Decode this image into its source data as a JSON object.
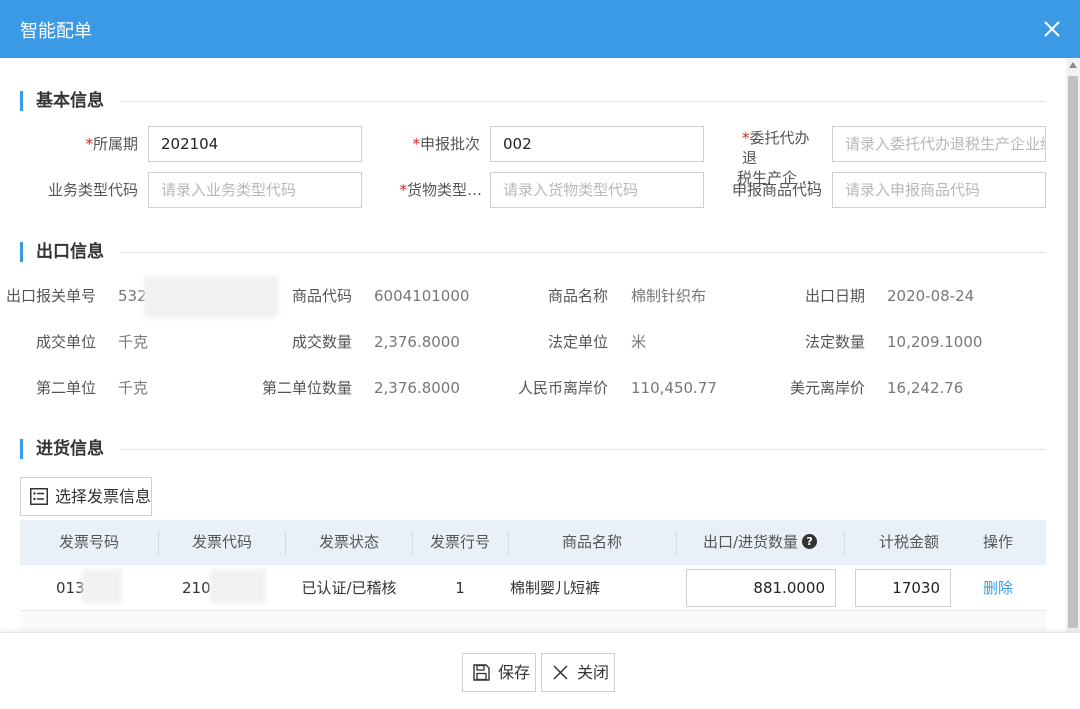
{
  "dialog": {
    "title": "智能配单",
    "colors": {
      "header": "#3a9ae6",
      "link": "#3a9ae6",
      "required": "#e02020"
    }
  },
  "sections": {
    "basic": "基本信息",
    "export": "出口信息",
    "purchase": "进货信息"
  },
  "basic_form": {
    "period_label": "所属期",
    "period_value": "202104",
    "batch_label": "申报批次",
    "batch_value": "002",
    "entrust_label_line1": "委托代办退",
    "entrust_label_line2": "税生产企 …",
    "entrust_placeholder": "请录入委托代办退税生产企业纳",
    "biztype_label": "业务类型代码",
    "biztype_placeholder": "请录入业务类型代码",
    "goodstype_label": "货物类型…",
    "goodstype_placeholder": "请录入货物类型代码",
    "declaregoods_label": "申报商品代码",
    "declaregoods_placeholder": "请录入申报商品代码"
  },
  "export_info": {
    "customs_no_label": "出口报关单号",
    "customs_no_value": "532",
    "goods_code_label": "商品代码",
    "goods_code_value": "6004101000",
    "goods_name_label": "商品名称",
    "goods_name_value": "棉制针织布",
    "export_date_label": "出口日期",
    "export_date_value": "2020-08-24",
    "deal_unit_label": "成交单位",
    "deal_unit_value": "千克",
    "deal_qty_label": "成交数量",
    "deal_qty_value": "2,376.8000",
    "legal_unit_label": "法定单位",
    "legal_unit_value": "米",
    "legal_qty_label": "法定数量",
    "legal_qty_value": "10,209.1000",
    "second_unit_label": "第二单位",
    "second_unit_value": "千克",
    "second_qty_label": "第二单位数量",
    "second_qty_value": "2,376.8000",
    "rmb_fob_label": "人民币离岸价",
    "rmb_fob_value": "110,450.77",
    "usd_fob_label": "美元离岸价",
    "usd_fob_value": "16,242.76"
  },
  "purchase": {
    "select_invoice_label": "选择发票信息",
    "columns": [
      "发票号码",
      "发票代码",
      "发票状态",
      "发票行号",
      "商品名称",
      "出口/进货数量",
      "计税金额",
      "操作"
    ],
    "help_icon": "?",
    "rows": [
      {
        "invoice_no": "013",
        "invoice_code": "210",
        "status": "已认证/已稽核",
        "line_no": "1",
        "goods_name": "棉制婴儿短裤",
        "quantity": "881.0000",
        "tax_amount": "17030",
        "action": "删除"
      }
    ]
  },
  "footer": {
    "save_label": "保存",
    "close_label": "关闭"
  }
}
